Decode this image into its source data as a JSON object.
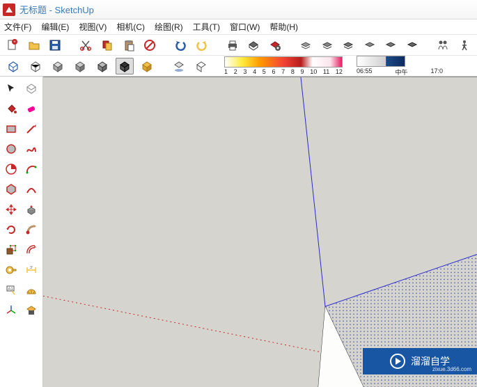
{
  "window": {
    "title": "无标题 - SketchUp"
  },
  "menubar": {
    "file": "文件(F)",
    "edit": "编辑(E)",
    "view": "视图(V)",
    "camera": "相机(C)",
    "draw": "绘图(R)",
    "tools": "工具(T)",
    "window": "窗口(W)",
    "help": "帮助(H)"
  },
  "toolbar1": {
    "new": "new-file",
    "open": "open-file",
    "save": "save",
    "cut": "cut",
    "copy": "copy",
    "paste": "paste",
    "delete": "delete",
    "undo": "undo",
    "redo": "redo",
    "print": "print",
    "model_info": "model-info",
    "preferences": "preferences",
    "layer1": "layer-1",
    "layer2": "layer-2",
    "layer3": "layer-3",
    "layer4": "layer-4",
    "layer5": "layer-5",
    "layer6": "layer-6",
    "people1": "people-1",
    "walk": "walk"
  },
  "toolbar2": {
    "style1": "wireframe",
    "style2": "hidden-line",
    "style3": "shaded",
    "style4": "shaded-textures",
    "style5": "monochrome",
    "style6": "xray",
    "style7": "back-edges",
    "shadow_on": "shadow-toggle",
    "shadow_off": "shadow-settings",
    "ticks": [
      "1",
      "2",
      "3",
      "4",
      "5",
      "6",
      "7",
      "8",
      "9",
      "10",
      "11",
      "12"
    ],
    "time_left": "06:55",
    "time_mid": "中午",
    "time_right": "17:0"
  },
  "sidetools": {
    "select": "select",
    "component": "make-component",
    "paint": "paint-bucket",
    "eraser": "eraser",
    "rect": "rectangle",
    "line": "line",
    "circle": "circle",
    "freehand": "freehand",
    "pie": "arc-pie",
    "arc": "arc",
    "polygon": "polygon",
    "arc2": "arc-2pt",
    "move": "move",
    "pushpull": "push-pull",
    "rotate": "rotate",
    "followme": "follow-me",
    "scale": "scale",
    "offset": "offset",
    "tape": "tape-measure",
    "dimension": "dimension",
    "text": "text",
    "protractor": "protractor",
    "axes": "axes",
    "section": "section-plane"
  },
  "watermark": {
    "brand": "溜溜自学",
    "url": "zixue.3d66.com"
  }
}
